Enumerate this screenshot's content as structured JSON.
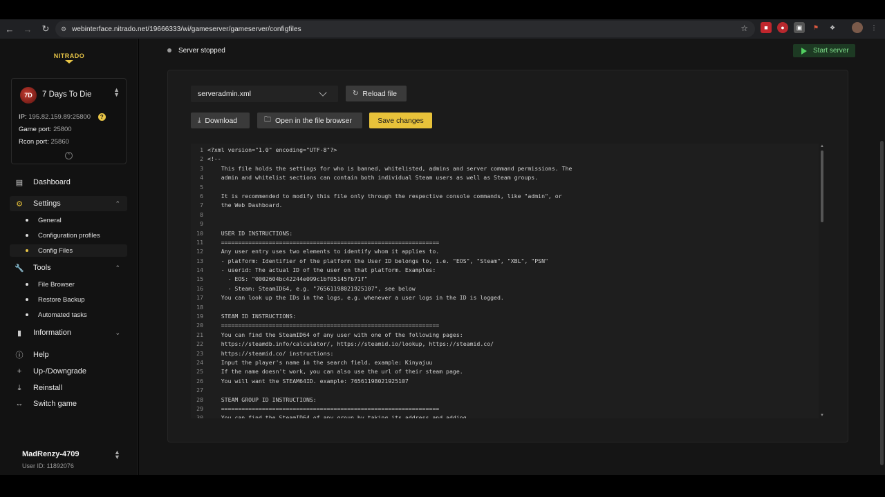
{
  "browser": {
    "url": "webinterface.nitrado.net/19666333/wi/gameserver/gameserver/configfiles"
  },
  "sidebar": {
    "logo": "NITRADO",
    "game": {
      "name": "7 Days To Die",
      "ip_label": "IP:",
      "ip_value": "195.82.159.89:25800",
      "game_port_label": "Game port:",
      "game_port_value": "25800",
      "rcon_port_label": "Rcon port:",
      "rcon_port_value": "25860"
    },
    "nav": {
      "dashboard": "Dashboard",
      "settings": "Settings",
      "general": "General",
      "config_profiles": "Configuration profiles",
      "config_files": "Config Files",
      "tools": "Tools",
      "file_browser": "File Browser",
      "restore_backup": "Restore Backup",
      "automated_tasks": "Automated tasks",
      "information": "Information",
      "help": "Help",
      "up_downgrade": "Up-/Downgrade",
      "reinstall": "Reinstall",
      "switch_game": "Switch game"
    },
    "user": {
      "name": "MadRenzy-4709",
      "id": "User ID: 11892076"
    }
  },
  "header": {
    "status": "Server stopped",
    "start_button": "Start server"
  },
  "toolbar": {
    "selected_file": "serveradmin.xml",
    "reload": "Reload file",
    "download": "Download",
    "open_browser": "Open in the file browser",
    "save": "Save changes"
  },
  "editor": {
    "lines": [
      "<?xml version=\"1.0\" encoding=\"UTF-8\"?>",
      "<!--",
      "    This file holds the settings for who is banned, whitelisted, admins and server command permissions. The",
      "    admin and whitelist sections can contain both individual Steam users as well as Steam groups.",
      "",
      "    It is recommended to modify this file only through the respective console commands, like \"admin\", or",
      "    the Web Dashboard.",
      "",
      "",
      "    USER ID INSTRUCTIONS:",
      "    ================================================================",
      "    Any user entry uses two elements to identify whom it applies to.",
      "    - platform: Identifier of the platform the User ID belongs to, i.e. \"EOS\", \"Steam\", \"XBL\", \"PSN\"",
      "    - userid: The actual ID of the user on that platform. Examples:",
      "      - EOS: \"0002604bc42244e099c1bf05145fb71f\"",
      "      - Steam: SteamID64, e.g. \"76561198021925107\", see below",
      "    You can look up the IDs in the logs, e.g. whenever a user logs in the ID is logged.",
      "",
      "    STEAM ID INSTRUCTIONS:",
      "    ================================================================",
      "    You can find the SteamID64 of any user with one of the following pages:",
      "    https://steamdb.info/calculator/, https://steamid.io/lookup, https://steamid.co/",
      "    https://steamid.co/ instructions:",
      "    Input the player's name in the search field. example: Kinyajuu",
      "    If the name doesn't work, you can also use the url of their steam page.",
      "    You will want the STEAM64ID. example: 76561198021925107",
      "",
      "    STEAM GROUP ID INSTRUCTIONS:",
      "    ================================================================",
      "    You can find the SteamID64 of any group by taking its address and adding"
    ],
    "line_numbers": [
      "1",
      "2",
      "3",
      "4",
      "5",
      "6",
      "7",
      "8",
      "9",
      "10",
      "11",
      "12",
      "13",
      "14",
      "15",
      "16",
      "17",
      "18",
      "19",
      "20",
      "21",
      "22",
      "23",
      "24",
      "25",
      "26",
      "27",
      "28",
      "29",
      "30"
    ]
  },
  "colors": {
    "accent": "#e8c23a",
    "start_green": "#52d061"
  }
}
